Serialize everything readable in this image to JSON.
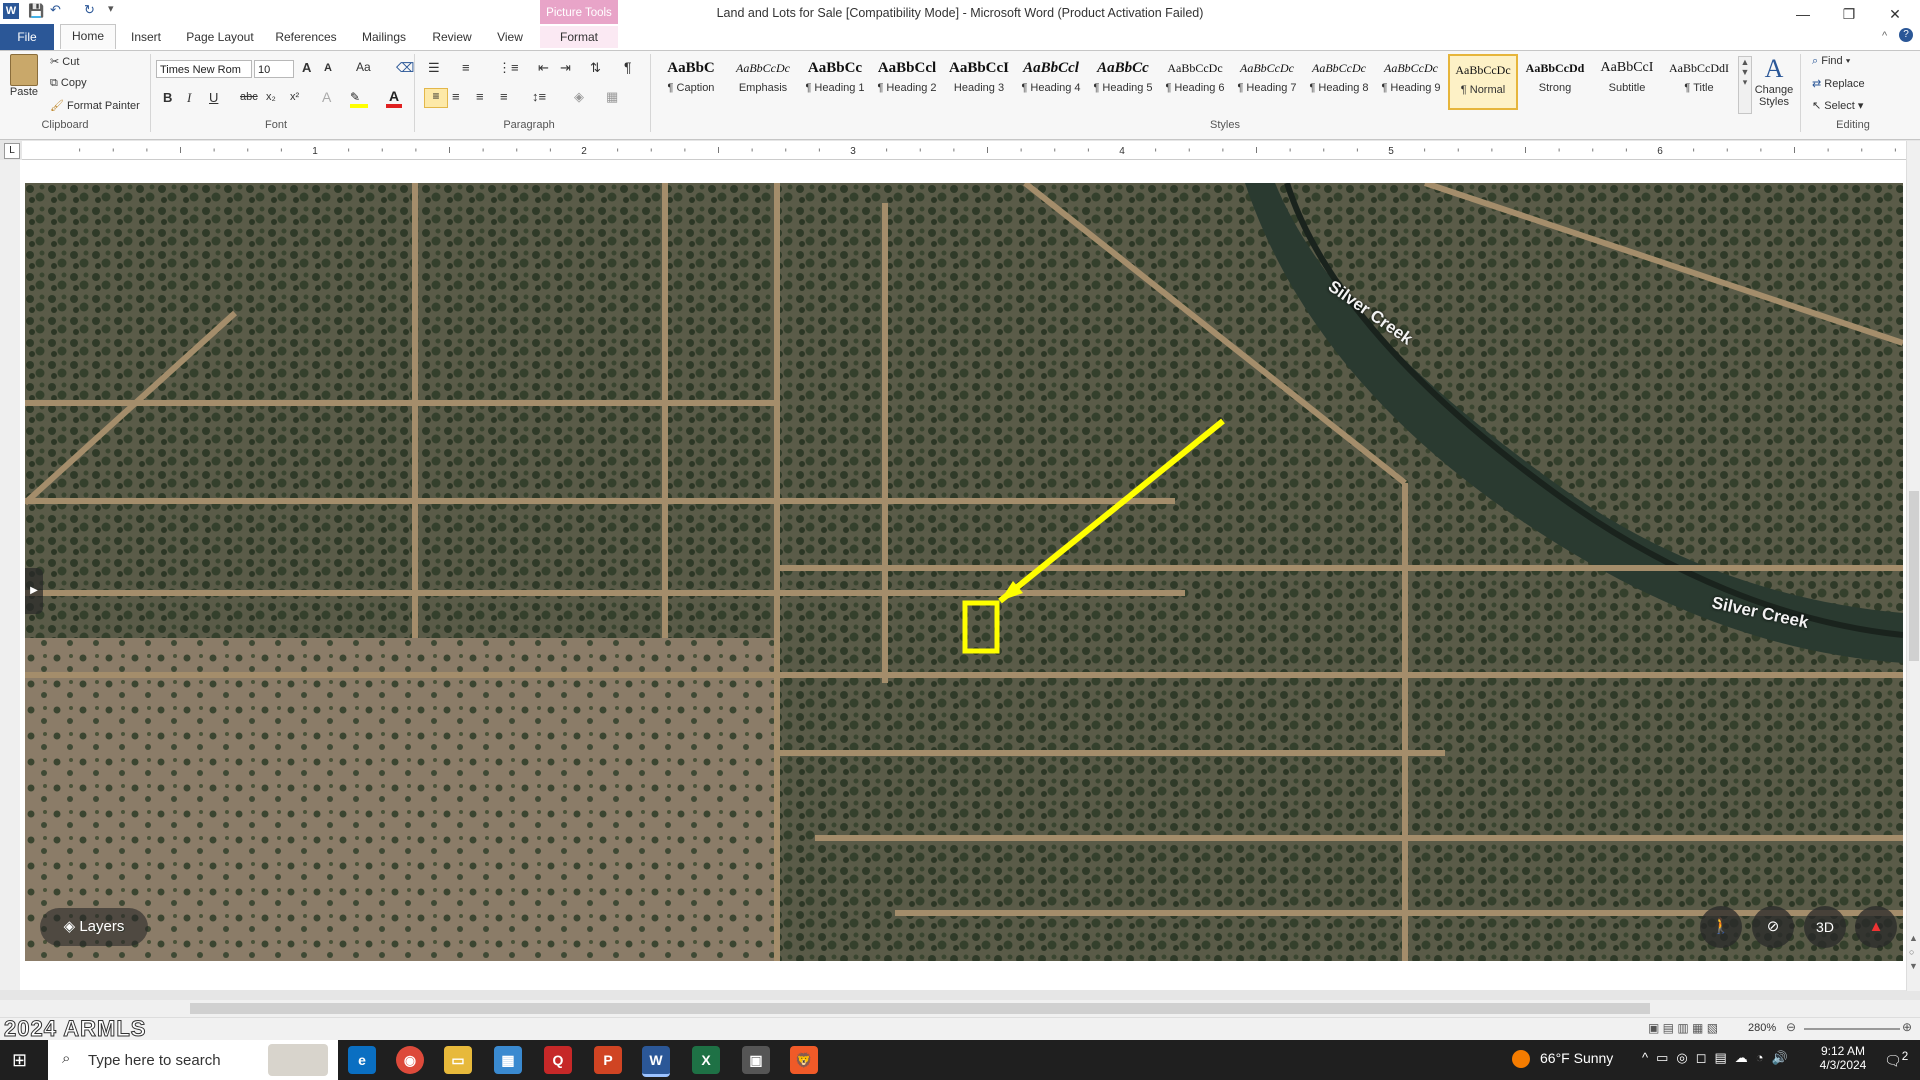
{
  "window": {
    "title": "Land and Lots for Sale [Compatibility Mode]  -  Microsoft Word (Product Activation Failed)",
    "contextual_tab_group": "Picture Tools",
    "minimize": "—",
    "restore": "❐",
    "close": "✕"
  },
  "tabs": [
    "File",
    "Home",
    "Insert",
    "Page Layout",
    "References",
    "Mailings",
    "Review",
    "View",
    "Format"
  ],
  "ribbon": {
    "clipboard": {
      "paste": "Paste",
      "cut": "Cut",
      "copy": "Copy",
      "format_painter": "Format Painter",
      "label": "Clipboard"
    },
    "font": {
      "font_name": "Times New Rom",
      "font_size": "10",
      "label": "Font",
      "bold": "B",
      "italic": "I",
      "underline": "U",
      "strike": "abc",
      "sub": "x₂",
      "sup": "x²",
      "grow": "A",
      "shrink": "A",
      "case": "Aa"
    },
    "paragraph": {
      "label": "Paragraph"
    },
    "styles": {
      "label": "Styles",
      "items": [
        {
          "preview": "AaBbC",
          "name": "¶ Caption"
        },
        {
          "preview": "AaBbCcDc",
          "name": "Emphasis"
        },
        {
          "preview": "AaBbCc",
          "name": "¶ Heading 1"
        },
        {
          "preview": "AaBbCcl",
          "name": "¶ Heading 2"
        },
        {
          "preview": "AaBbCcI",
          "name": "Heading 3"
        },
        {
          "preview": "AaBbCcl",
          "name": "¶ Heading 4"
        },
        {
          "preview": "AaBbCc",
          "name": "¶ Heading 5"
        },
        {
          "preview": "AaBbCcDc",
          "name": "¶ Heading 6"
        },
        {
          "preview": "AaBbCcDc",
          "name": "¶ Heading 7"
        },
        {
          "preview": "AaBbCcDc",
          "name": "¶ Heading 8"
        },
        {
          "preview": "AaBbCcDc",
          "name": "¶ Heading 9"
        },
        {
          "preview": "AaBbCcDc",
          "name": "¶ Normal"
        },
        {
          "preview": "AaBbCcDd",
          "name": "Strong"
        },
        {
          "preview": "AaBbCcI",
          "name": "Subtitle"
        },
        {
          "preview": "AaBbCcDdI",
          "name": "¶ Title"
        }
      ],
      "change_styles": "Change Styles"
    },
    "editing": {
      "label": "Editing",
      "find": "Find",
      "replace": "Replace",
      "select": "Select"
    }
  },
  "ruler": {
    "numbers": [
      "1",
      "2",
      "3",
      "4",
      "5",
      "6"
    ]
  },
  "map": {
    "labels": [
      "Silver Creek",
      "Silver Creek"
    ],
    "layers_button": "Layers",
    "btn_3d": "3D",
    "watermark": "2024 ARMLS"
  },
  "status": {
    "zoom": "280%"
  },
  "taskbar": {
    "search_placeholder": "Type here to search",
    "weather": "66°F  Sunny",
    "time": "9:12 AM",
    "date": "4/3/2024",
    "notifications": "2"
  },
  "colors": {
    "word_blue": "#2b5797",
    "picture_tools_pink": "#e8a4c8",
    "highlight_yellow": "#ffff00",
    "creek_dark": "#2a3a30"
  }
}
